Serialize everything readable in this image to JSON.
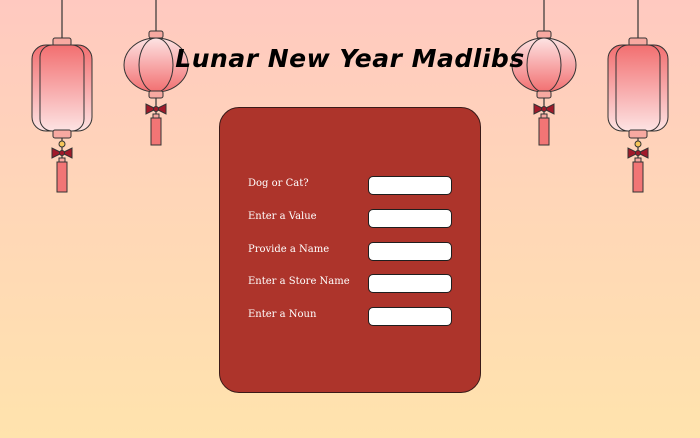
{
  "page": {
    "title": "Lunar New Year Madlibs"
  },
  "form": {
    "fields": [
      {
        "label": "Dog or Cat?",
        "value": ""
      },
      {
        "label": "Enter a Value",
        "value": ""
      },
      {
        "label": "Provide a Name",
        "value": ""
      },
      {
        "label": "Enter a Store Name",
        "value": ""
      },
      {
        "label": "Enter a Noun",
        "value": ""
      }
    ]
  },
  "decorations": {
    "lanterns": [
      "tall-lantern",
      "round-lantern",
      "round-lantern",
      "tall-lantern"
    ]
  },
  "colors": {
    "background_top": "#ffc9c0",
    "background_bottom": "#ffe3ad",
    "card": "#ad342b",
    "lantern_light": "#fbe0e0",
    "lantern_dark": "#f26f70",
    "tassel": "#f27575",
    "knot": "#a01a2a"
  }
}
